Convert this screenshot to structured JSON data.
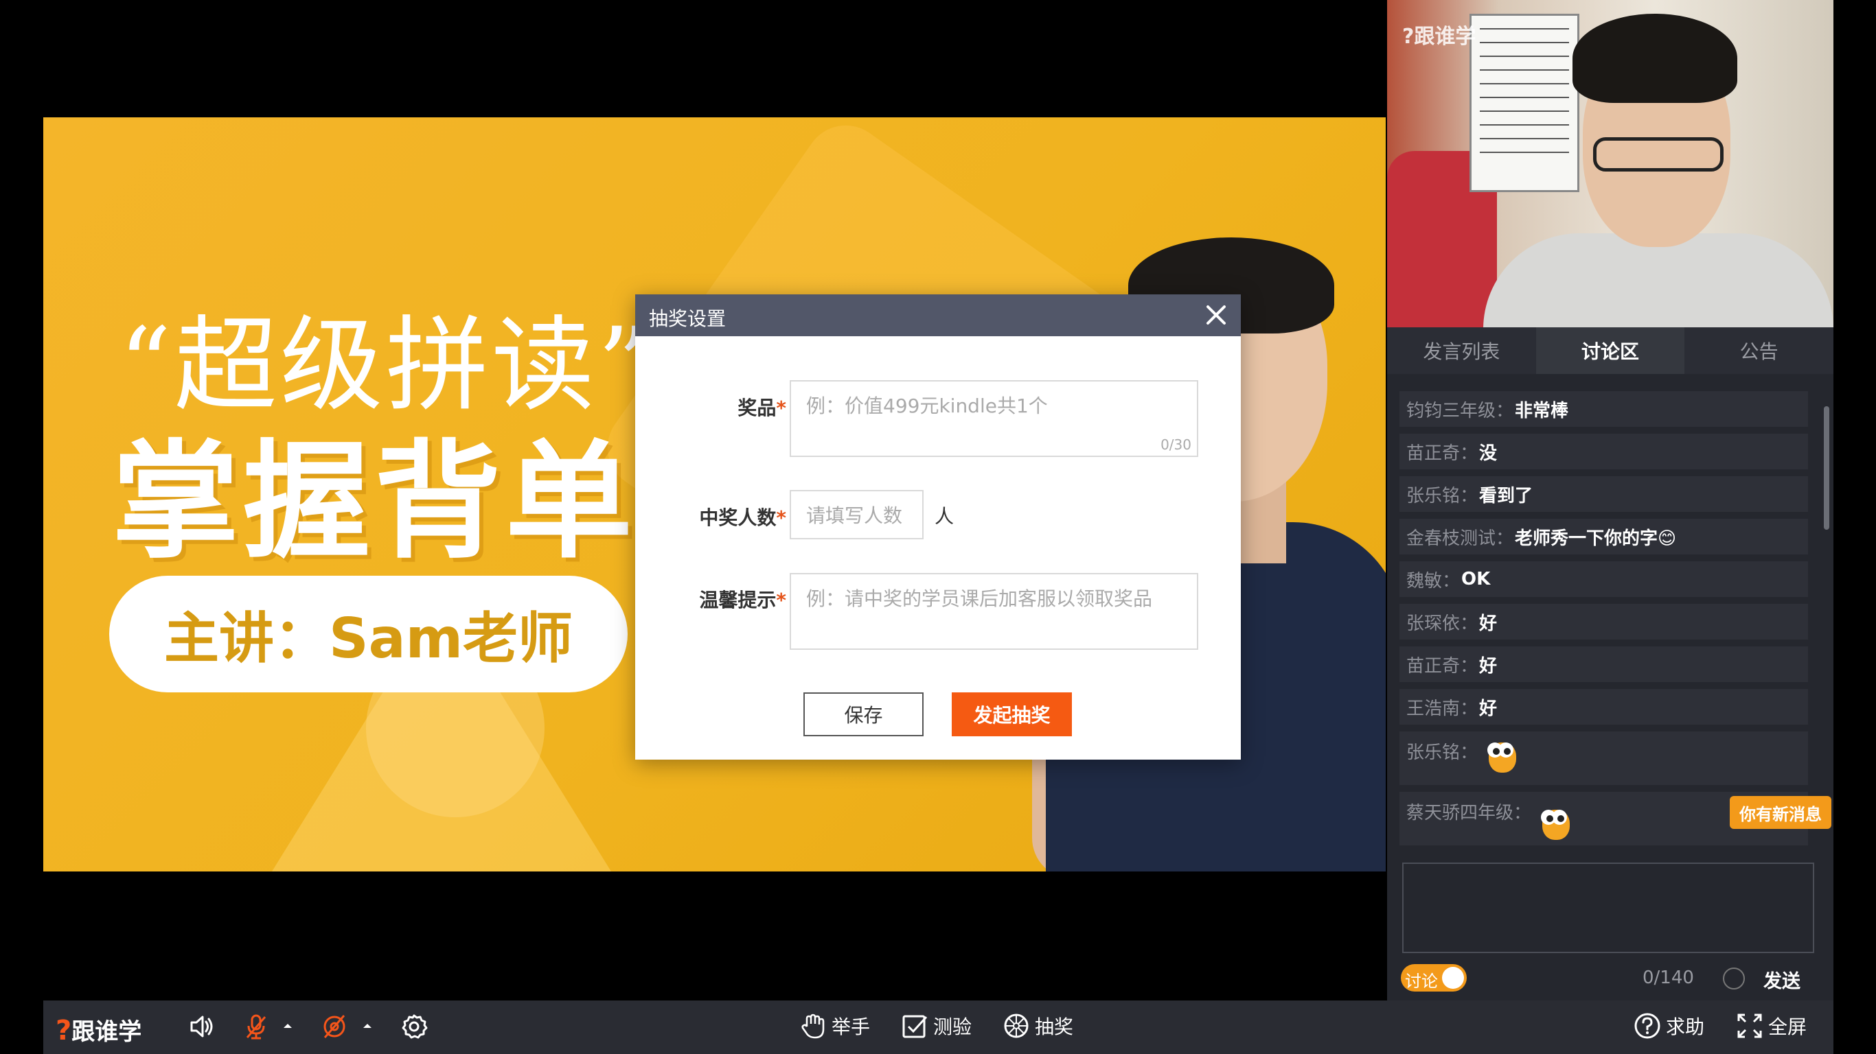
{
  "slide": {
    "title_line1": "“超级拼读”5",
    "title_line2": "掌握背单词",
    "presenter": "主讲：Sam老师"
  },
  "dialog": {
    "title": "抽奖设置",
    "prize_label": "奖品",
    "prize_placeholder": "例：价值499元kindle共1个",
    "prize_counter": "0/30",
    "winners_label": "中奖人数",
    "winners_placeholder": "请填写人数",
    "winners_unit": "人",
    "tip_label": "温馨提示",
    "tip_placeholder": "例：请中奖的学员课后加客服以领取奖品",
    "required_mark": "*",
    "save_label": "保存",
    "start_label": "发起抽奖"
  },
  "video": {
    "logo_text": "?跟谁学"
  },
  "tabs": [
    {
      "label": "发言列表",
      "active": false
    },
    {
      "label": "讨论区",
      "active": true
    },
    {
      "label": "公告",
      "active": false
    }
  ],
  "chat": {
    "messages": [
      {
        "user": "钧钧三年级：",
        "text": "非常棒"
      },
      {
        "user": "苗正奇：",
        "text": "没"
      },
      {
        "user": "张乐铭：",
        "text": "看到了"
      },
      {
        "user": "金春枝测试：",
        "text": "老师秀一下你的字😊"
      },
      {
        "user": "魏敏：",
        "text": "OK"
      },
      {
        "user": "张琛依：",
        "text": "好"
      },
      {
        "user": "苗正奇：",
        "text": "好"
      },
      {
        "user": "王浩南：",
        "text": "好"
      },
      {
        "user": "张乐铭：",
        "text": "",
        "sticker": "owl-sticker"
      },
      {
        "user": "蔡天骄四年级：",
        "text": "",
        "sticker": "owl-sticker"
      }
    ],
    "new_message_badge": "你有新消息",
    "discuss_toggle_label": "讨论",
    "char_count": "0/140",
    "send_label": "发送"
  },
  "toolbar": {
    "logo_mark": "?",
    "logo_text": "跟谁学",
    "raise_hand": "举手",
    "quiz": "测验",
    "lottery": "抽奖",
    "help": "求助",
    "fullscreen": "全屏"
  },
  "colors": {
    "accent_orange": "#f55a12",
    "badge_orange": "#f39a1a",
    "dialog_header": "#525769",
    "slide_yellow": "#f0b31f"
  }
}
